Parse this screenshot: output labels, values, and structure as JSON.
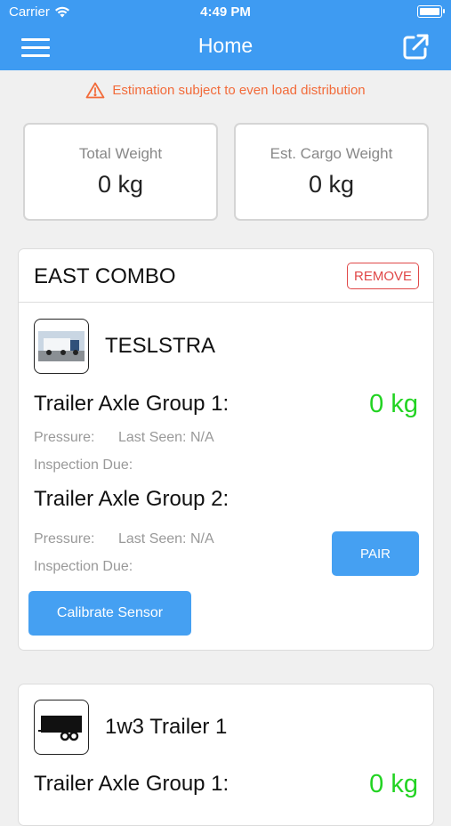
{
  "status_bar": {
    "carrier": "Carrier",
    "time": "4:49 PM"
  },
  "navbar": {
    "title": "Home"
  },
  "warning": {
    "text": "Estimation subject to even load distribution"
  },
  "summary": {
    "total_weight": {
      "label": "Total Weight",
      "value": "0 kg"
    },
    "cargo_weight": {
      "label": "Est. Cargo Weight",
      "value": "0 kg"
    }
  },
  "combo": {
    "title": "EAST COMBO",
    "remove_label": "REMOVE",
    "trailer_name": "TESLSTRA",
    "axle_groups": [
      {
        "label": "Trailer Axle Group 1:",
        "value": "0 kg",
        "pressure": "Pressure:",
        "last_seen": "Last Seen: N/A",
        "inspection": "Inspection Due:"
      },
      {
        "label": "Trailer Axle Group 2:",
        "pressure": "Pressure:",
        "last_seen": "Last Seen: N/A",
        "inspection": "Inspection Due:"
      }
    ],
    "pair_label": "PAIR",
    "calibrate_label": "Calibrate Sensor"
  },
  "second_trailer": {
    "trailer_name": "1w3 Trailer 1",
    "axle_groups": [
      {
        "label": "Trailer Axle Group 1:",
        "value": "0 kg"
      }
    ]
  },
  "colors": {
    "header_blue": "#3e9bf2",
    "warning_orange": "#f26b3a",
    "value_green": "#22d322",
    "remove_red": "#e04848",
    "button_blue": "#45a0f2"
  }
}
